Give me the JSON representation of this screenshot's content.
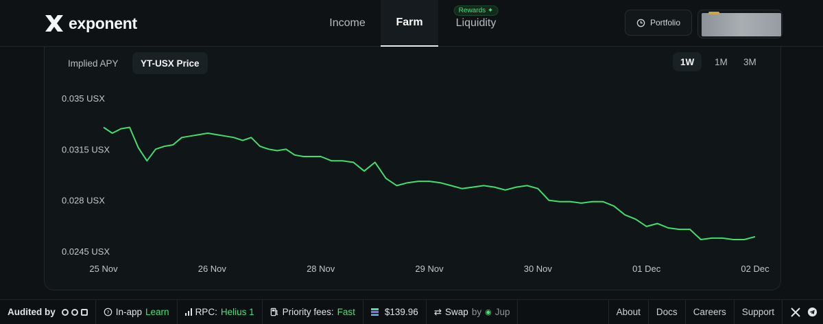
{
  "header": {
    "logo_text": "exponent",
    "nav": [
      {
        "label": "Income",
        "active": false
      },
      {
        "label": "Farm",
        "active": true
      },
      {
        "label": "Liquidity",
        "active": false,
        "badge": "Rewards"
      }
    ],
    "portfolio_label": "Portfolio",
    "wallet_redacted": true
  },
  "chart_panel": {
    "tabs": [
      {
        "label": "Implied APY",
        "active": false
      },
      {
        "label": "YT-USX Price",
        "active": true
      }
    ],
    "ranges": [
      {
        "label": "1W",
        "active": true
      },
      {
        "label": "1M",
        "active": false
      },
      {
        "label": "3M",
        "active": false
      }
    ]
  },
  "chart_data": {
    "type": "line",
    "title": "",
    "xlabel": "",
    "ylabel": "",
    "y_ticks": [
      {
        "label": "0.035 USX",
        "value": 0.035
      },
      {
        "label": "0.0315 USX",
        "value": 0.0315
      },
      {
        "label": "0.028 USX",
        "value": 0.028
      },
      {
        "label": "0.0245 USX",
        "value": 0.0245
      }
    ],
    "x_ticks": [
      {
        "label": "25 Nov",
        "x": 0
      },
      {
        "label": "26 Nov",
        "x": 1
      },
      {
        "label": "28 Nov",
        "x": 2
      },
      {
        "label": "29 Nov",
        "x": 3
      },
      {
        "label": "30 Nov",
        "x": 4
      },
      {
        "label": "01 Dec",
        "x": 5
      },
      {
        "label": "02 Dec",
        "x": 6
      }
    ],
    "xlim": [
      0,
      6
    ],
    "ylim": [
      0.0245,
      0.035
    ],
    "grid": false,
    "line_color": "#3ee06f",
    "series": [
      {
        "x": [
          0,
          0.08,
          0.16,
          0.24,
          0.32,
          0.4,
          0.48,
          0.56,
          0.64,
          0.72,
          0.8,
          0.88,
          0.96,
          1.04,
          1.12,
          1.2,
          1.28,
          1.36,
          1.44,
          1.52,
          1.6,
          1.68,
          1.76,
          1.84,
          1.92,
          2.0,
          2.1,
          2.2,
          2.3,
          2.4,
          2.5,
          2.6,
          2.7,
          2.8,
          2.9,
          3.0,
          3.1,
          3.2,
          3.3,
          3.4,
          3.5,
          3.6,
          3.7,
          3.8,
          3.9,
          4.0,
          4.1,
          4.2,
          4.3,
          4.4,
          4.5,
          4.6,
          4.7,
          4.8,
          4.9,
          5.0,
          5.1,
          5.2,
          5.3,
          5.4,
          5.5,
          5.6,
          5.7,
          5.8,
          5.9,
          6.0
        ],
        "y": [
          0.033,
          0.0326,
          0.0329,
          0.033,
          0.0316,
          0.0307,
          0.0315,
          0.0317,
          0.0318,
          0.0323,
          0.0324,
          0.0325,
          0.0326,
          0.0325,
          0.0324,
          0.0323,
          0.0321,
          0.0323,
          0.0317,
          0.0315,
          0.0314,
          0.0315,
          0.0311,
          0.031,
          0.031,
          0.031,
          0.0307,
          0.0307,
          0.0306,
          0.03,
          0.0306,
          0.0295,
          0.029,
          0.0292,
          0.0293,
          0.0293,
          0.0292,
          0.029,
          0.0288,
          0.0289,
          0.029,
          0.0289,
          0.0287,
          0.0289,
          0.029,
          0.0288,
          0.028,
          0.0279,
          0.0279,
          0.0278,
          0.0279,
          0.0279,
          0.0276,
          0.027,
          0.0267,
          0.0262,
          0.0264,
          0.0261,
          0.026,
          0.026,
          0.0253,
          0.0254,
          0.0254,
          0.0253,
          0.0253,
          0.0255
        ]
      }
    ]
  },
  "footer": {
    "audited_label": "Audited by",
    "in_app_label": "In-app",
    "learn_label": "Learn",
    "rpc_label": "RPC:",
    "rpc_value": "Helius 1",
    "fees_label": "Priority fees:",
    "fees_value": "Fast",
    "sol_price": "$139.96",
    "swap_label": "Swap",
    "swap_by": "by",
    "swap_provider": "Jup",
    "links": [
      "About",
      "Docs",
      "Careers",
      "Support"
    ]
  }
}
